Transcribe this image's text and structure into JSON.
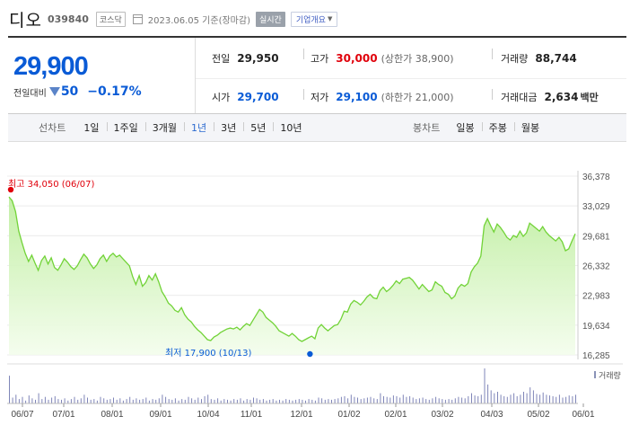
{
  "header": {
    "stock_name": "디오",
    "stock_code": "039840",
    "market_badge": "코스닥",
    "date_text": "2023.06.05 기준(장마감)",
    "realtime_badge": "실시간",
    "company_button": "기업개요"
  },
  "summary": {
    "price": "29,900",
    "change_label": "전일대비",
    "change_amount": "50",
    "change_pct": "−0.17%",
    "prev_close": {
      "label": "전일",
      "value": "29,950"
    },
    "high": {
      "label": "고가",
      "value": "30,000",
      "sub": "(상한가 38,900)"
    },
    "volume": {
      "label": "거래량",
      "value": "88,744"
    },
    "open": {
      "label": "시가",
      "value": "29,700"
    },
    "low": {
      "label": "저가",
      "value": "29,100",
      "sub": "(하한가 21,000)"
    },
    "amount": {
      "label": "거래대금",
      "value": "2,634",
      "unit": "백만"
    }
  },
  "tabs": {
    "line_label": "선차트",
    "line_items": [
      "1일",
      "1주일",
      "3개월",
      "1년",
      "3년",
      "5년",
      "10년"
    ],
    "active": "1년",
    "candle_label": "봉차트",
    "candle_items": [
      "일봉",
      "주봉",
      "월봉"
    ]
  },
  "colors": {
    "up": "#e0000b",
    "down": "#0a5bd6",
    "area_line": "#72d338",
    "area_fill": "#c8f0a8"
  },
  "chart_data": {
    "type": "area",
    "y_ticks": [
      "36,378",
      "33,029",
      "29,681",
      "26,332",
      "22,983",
      "19,634",
      "16,285"
    ],
    "ylim": [
      16285,
      36378
    ],
    "x_ticks": [
      "06/07",
      "07/01",
      "08/01",
      "09/01",
      "10/04",
      "11/01",
      "12/01",
      "01/02",
      "02/01",
      "03/02",
      "04/03",
      "05/02",
      "06/01"
    ],
    "high_annotation": "최고 34,050 (06/07)",
    "low_annotation": "최저 17,900 (10/13)",
    "volume_legend": "거래량",
    "values": [
      34050,
      33600,
      32400,
      30200,
      28900,
      27700,
      26800,
      27500,
      26600,
      25800,
      26900,
      27400,
      26500,
      27200,
      26100,
      25800,
      26400,
      27100,
      26700,
      26200,
      25900,
      26300,
      27000,
      27600,
      27200,
      26500,
      26000,
      26400,
      27100,
      27500,
      26800,
      27400,
      27700,
      27300,
      27500,
      27100,
      26700,
      26300,
      25100,
      24200,
      25200,
      24000,
      24400,
      25200,
      24700,
      25400,
      24500,
      23400,
      22800,
      22100,
      21800,
      21300,
      21100,
      21600,
      20800,
      20300,
      20000,
      19500,
      19100,
      18800,
      18400,
      18000,
      17900,
      18300,
      18500,
      18800,
      19000,
      19200,
      19300,
      19200,
      19400,
      19100,
      19500,
      19800,
      19600,
      20200,
      20800,
      21400,
      21100,
      20500,
      20200,
      19900,
      19500,
      19000,
      18800,
      18600,
      18400,
      18700,
      18400,
      18000,
      17800,
      18000,
      18200,
      18400,
      18100,
      19300,
      19700,
      19300,
      19000,
      19300,
      19600,
      19700,
      20300,
      21200,
      21100,
      22000,
      22400,
      22200,
      21900,
      22300,
      22800,
      23100,
      22700,
      22600,
      23500,
      23900,
      23400,
      23700,
      24100,
      24600,
      24300,
      24800,
      24900,
      25000,
      24700,
      24200,
      23700,
      24200,
      23800,
      23400,
      23600,
      24500,
      24200,
      24000,
      23300,
      23100,
      22600,
      22900,
      23800,
      24200,
      24000,
      24300,
      25600,
      26200,
      26600,
      27400,
      30800,
      31600,
      30800,
      30100,
      31000,
      30600,
      30100,
      29500,
      29200,
      29700,
      29500,
      30200,
      29600,
      30000,
      31100,
      30800,
      30500,
      30200,
      30700,
      30100,
      29700,
      29400,
      29100,
      29500,
      29000,
      28000,
      28200,
      29100,
      29900
    ],
    "volumes": [
      38,
      8,
      12,
      6,
      9,
      4,
      11,
      7,
      5,
      14,
      6,
      9,
      5,
      8,
      10,
      6,
      5,
      7,
      4,
      6,
      9,
      5,
      7,
      12,
      8,
      5,
      6,
      4,
      9,
      7,
      5,
      6,
      8,
      5,
      7,
      4,
      6,
      9,
      5,
      7,
      5,
      6,
      8,
      4,
      6,
      5,
      7,
      12,
      9,
      6,
      5,
      7,
      4,
      6,
      5,
      9,
      7,
      5,
      8,
      6,
      10,
      12,
      6,
      5,
      7,
      4,
      6,
      5,
      4,
      6,
      5,
      7,
      4,
      6,
      5,
      8,
      7,
      5,
      6,
      4,
      5,
      6,
      4,
      5,
      4,
      6,
      5,
      4,
      5,
      6,
      5,
      4,
      6,
      5,
      4,
      8,
      7,
      5,
      6,
      5,
      6,
      7,
      9,
      10,
      7,
      12,
      9,
      8,
      6,
      7,
      8,
      9,
      7,
      6,
      14,
      10,
      9,
      8,
      11,
      10,
      8,
      12,
      9,
      10,
      8,
      6,
      7,
      8,
      6,
      5,
      7,
      9,
      7,
      6,
      5,
      6,
      5,
      7,
      9,
      8,
      7,
      10,
      14,
      11,
      10,
      12,
      48,
      26,
      18,
      14,
      16,
      12,
      10,
      9,
      12,
      14,
      10,
      12,
      16,
      14,
      22,
      18,
      13,
      12,
      15,
      12,
      11,
      10,
      9,
      12,
      8,
      9,
      11,
      10,
      12
    ]
  }
}
